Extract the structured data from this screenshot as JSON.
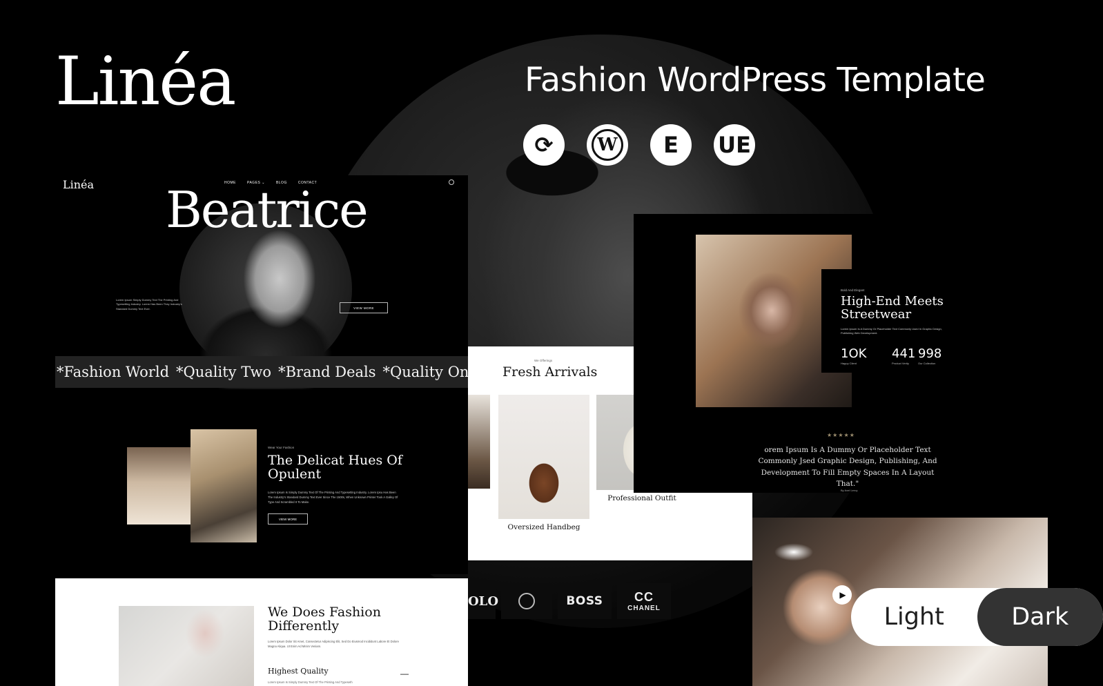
{
  "header": {
    "brand": "Linéa",
    "headline": "Fashion WordPress Template",
    "icons": [
      "sync-icon",
      "wordpress-icon",
      "elementor-icon",
      "ue-addons-icon"
    ]
  },
  "hero": {
    "logo": "Linéa",
    "nav": [
      "HOME",
      "PAGES ⌄",
      "BLOG",
      "CONTACT"
    ],
    "title": "Beatrice",
    "lead": "Lorem Ipsum Simply Dummy Text The Printing And Typesetting Industry. Lorem Has Been They Industry's Standard Dummy Text Ever.",
    "button": "VIEW MORE",
    "ticker": [
      "*Fashion World",
      "*Quality Two",
      "*Brand Deals",
      "*Quality One"
    ]
  },
  "delicate": {
    "kicker": "Wear Your Fashion",
    "title": "The Delicat Hues Of Opulent",
    "body": "Lorem Ipsum Is Simply Dummy Text Of The Printing And Typesetting Industry. Lorem Ipsu Has Been The Industry's Standard Dummy Text Ever Since The 1500s, When Unknown Printer Took A Galley Of Type And Scrambled It To Make.",
    "button": "VIEW MORE"
  },
  "fashion": {
    "title": "We Does Fashion Differently",
    "body": "Lorem Ipsum Dolor Sit Amet, Consectetur Adipiscing Elit, Sed Do Eiusmod Incididunt Labore Et Dolore Magna Aliqua. Ut Enim Ad Minim Veniam.",
    "feature": "Highest Quality",
    "feature_body": "Lorem Ipsum Is Simply Dummy Text Of The Printing And Typeseth"
  },
  "fresh": {
    "kicker": "We Offerings",
    "title": "Fresh Arrivals",
    "products": [
      "Oversized Handbeg",
      "Professional Outfit"
    ]
  },
  "brands": {
    "polo": "OLO",
    "boss": "BOSS",
    "chanel": "CHANEL"
  },
  "highend": {
    "kicker": "Bold And Elegant",
    "title": "High-End Meets Streetwear",
    "body": "Lorem Ipsum Is A Dummy Or Placeholder Text Commonly Used In Graphic Design, Publishing Web Development.",
    "stats": [
      {
        "value": "1OK",
        "label": "Happy Client"
      },
      {
        "value": "441",
        "label": "Product Verity"
      },
      {
        "value": "998",
        "label": "Our Collection"
      }
    ],
    "stars": "★★★★★",
    "quote": "orem Ipsum Is A Dummy Or Placeholder Text Commonly Jsed Graphic Design, Publishing, And Development To Fill Empty Spaces In A Layout That.\"",
    "author": "By Axel Leroy"
  },
  "theme_toggle": {
    "light": "Light",
    "dark": "Dark"
  }
}
